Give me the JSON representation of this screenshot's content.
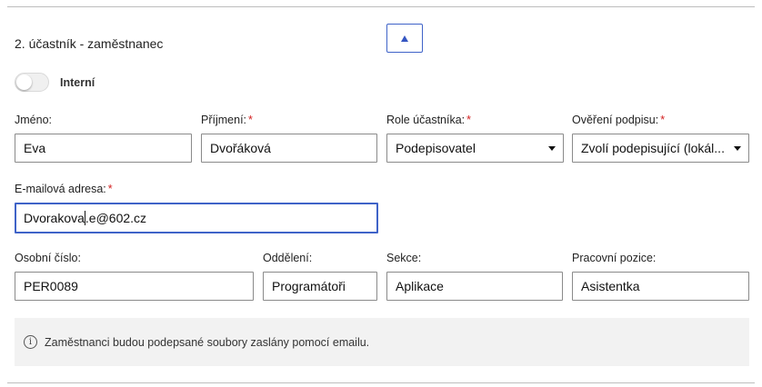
{
  "section": {
    "title": "2. účastník - zaměstnanec"
  },
  "internal_toggle": {
    "label": "Interní",
    "on": false
  },
  "fields": {
    "first_name": {
      "label": "Jméno:",
      "required": false,
      "value": "Eva"
    },
    "last_name": {
      "label": "Příjmení:",
      "required": true,
      "value": "Dvořáková"
    },
    "role": {
      "label": "Role účastníka:",
      "required": true,
      "value": "Podepisovatel"
    },
    "signature_verification": {
      "label": "Ověření podpisu:",
      "required": true,
      "value": "Zvolí podepisující (lokál..."
    },
    "email": {
      "label": "E-mailová adresa:",
      "required": true,
      "value_before_cursor": "Dvorakova",
      "value_after_cursor": ".e@602.cz"
    },
    "personal_number": {
      "label": "Osobní číslo:",
      "value": "PER0089"
    },
    "department": {
      "label": "Oddělení:",
      "value": "Programátoři"
    },
    "section": {
      "label": "Sekce:",
      "value": "Aplikace"
    },
    "position": {
      "label": "Pracovní pozice:",
      "value": "Asistentka"
    }
  },
  "required_marker": "*",
  "info": {
    "icon": "info-icon",
    "icon_glyph": "i",
    "text": "Zaměstnanci budou podepsané soubory zaslány pomocí emailu."
  },
  "colors": {
    "accent": "#3f63c8",
    "required": "#d32020",
    "info_background": "#f2f2f2"
  }
}
